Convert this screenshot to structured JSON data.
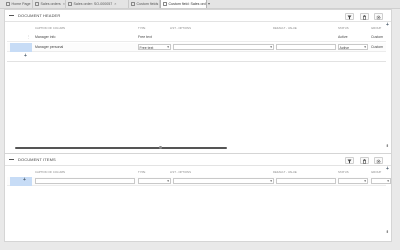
{
  "tabs": [
    {
      "label": "Home Page",
      "cls": "home"
    },
    {
      "label": "Sales orders",
      "cls": "t2"
    },
    {
      "label": "Sales order: SO-000057",
      "cls": "t3"
    },
    {
      "label": "Custom fields",
      "cls": "t4"
    },
    {
      "label": "Custom field: Sales ord",
      "cls": "active"
    }
  ],
  "header_section": {
    "title": "DOCUMENT HEADER",
    "columns": {
      "caption": "CAPTION OF COLUMN",
      "type": "TYPE",
      "list": "LIST - OPTIONS",
      "default": "DEFAULT - VALUE",
      "status": "STATUS",
      "group": "GROUP"
    },
    "rows": [
      {
        "caption": "Manager info",
        "type": "Free text",
        "status": "Active",
        "group": "Custom"
      },
      {
        "caption": "Manager personal",
        "type": "Free text",
        "status": "Active",
        "group": "Custom"
      }
    ]
  },
  "items_section": {
    "title": "DOCUMENT ITEMS",
    "columns": {
      "caption": "CAPTION OF COLUMN",
      "type": "TYPE",
      "list": "LIST - OPTIONS",
      "default": "DEFAULT - VALUE",
      "status": "STATUS",
      "group": "GROUP"
    }
  },
  "icons": {
    "close": "×",
    "dropdown": "▾",
    "plus": "+",
    "filter": "filter-icon",
    "delete": "trash-icon",
    "settings": "gear-icon"
  }
}
